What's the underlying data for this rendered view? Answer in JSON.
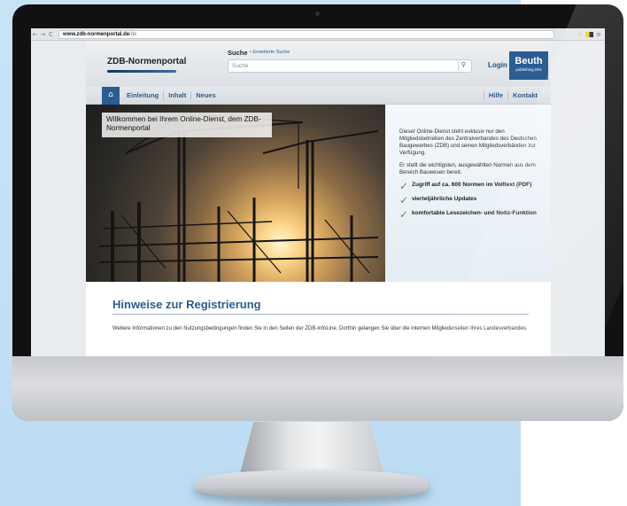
{
  "browser": {
    "url_host": "www.zdb-normenportal.de",
    "url_path": "/de"
  },
  "header": {
    "logo_text": "ZDB-Normenportal",
    "search_label": "Suche",
    "advanced_search": "• Erweiterte Suche",
    "search_placeholder": "Suche",
    "login_label": "Login",
    "partner_name": "Beuth",
    "partner_sub": "publishing DIN"
  },
  "nav": {
    "items": [
      "Einleitung",
      "Inhalt",
      "Neues"
    ],
    "right_items": [
      "Hilfe",
      "Kontakt"
    ]
  },
  "hero": {
    "title": "Willkommen bei Ihrem Online-Dienst, dem ZDB-Normenportal",
    "paragraph1": "Dieser Online-Dienst steht exklusiv nur den Mitgliedsbetrieben des Zentralverbandes des Deutschen Baugewerbes (ZDB) und seinen Mitgliedsverbänden zur Verfügung.",
    "paragraph2": "Er stellt die wichtigsten, ausgewählten Normen aus dem Bereich Bauwesen bereit.",
    "features": [
      "Zugriff auf ca. 600 Normen im Volltext (PDF)",
      "vierteljährliche Updates",
      "komfortable Lesezeichen- und Notiz-Funktion"
    ]
  },
  "registration": {
    "title": "Hinweise zur Registrierung",
    "text": "Weitere Informationen zu den Nutzungsbedingungen finden Sie in den Seiten der ZDB-InfoLine. Dorthin gelangen Sie über die internen Mitgliederseiten Ihres Landesverbandes."
  },
  "icons": {
    "home": "home-icon",
    "search": "search-icon",
    "check": "check-icon"
  },
  "colors": {
    "brand_blue": "#2a5d92",
    "check_green": "#42a82c",
    "background_blue": "#c3e0f5"
  }
}
